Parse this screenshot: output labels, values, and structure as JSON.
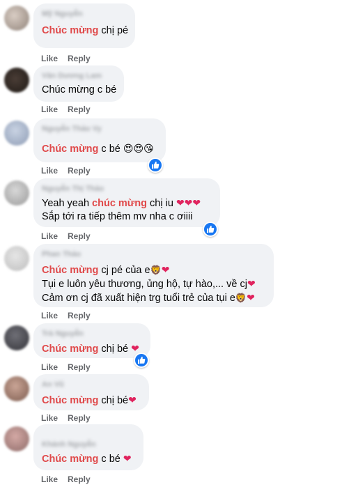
{
  "actions": {
    "like_label": "Like",
    "reply_label": "Reply"
  },
  "comments": [
    {
      "author": "Mỹ Nguyễn",
      "lines": [
        {
          "highlight": "Chúc mừng",
          "text": " chị pé"
        }
      ]
    },
    {
      "author": "Vân Dương Lam",
      "lines": [
        {
          "highlight": "",
          "text": "Chúc mừng c bé"
        }
      ]
    },
    {
      "author": "Nguyễn Thảo Vy",
      "lines": [
        {
          "highlight": "Chúc mừng",
          "text": " c bé",
          "suffix": "😍😍😘"
        }
      ]
    },
    {
      "author": "Nguyễn Thị Thảo",
      "lines": [
        {
          "prefix": "Yeah yeah ",
          "highlight": "chúc mừng",
          "text": " chị iu",
          "hearts": "❤❤❤"
        },
        {
          "text": "Sắp tới ra tiếp thêm mv nha c ơiiii"
        }
      ]
    },
    {
      "author": "Phan Thảo",
      "lines": [
        {
          "highlight": "Chúc mừng",
          "text": " cj pé của e",
          "lion": "🦁",
          "hearts": "❤"
        },
        {
          "text": "Tụi e luôn yêu thương, ủng hộ, tự hào,... về cj",
          "hearts": "❤"
        },
        {
          "text": "Cảm ơn cj đã xuất hiện trg tuổi trẻ của tụi e",
          "lion": "🦁",
          "hearts": "❤"
        }
      ]
    },
    {
      "author": "Trà Nguyễn",
      "lines": [
        {
          "highlight": "Chúc mừng",
          "text": " chị bé ",
          "hearts": "❤"
        }
      ]
    },
    {
      "author": "An Vũ",
      "lines": [
        {
          "highlight": "Chúc mừng",
          "text": " chị bé",
          "hearts": "❤"
        }
      ]
    },
    {
      "author": "Khánh Nguyễn",
      "lines": [
        {
          "highlight": "Chúc mừng",
          "text": " c bé ",
          "hearts": "❤"
        }
      ]
    }
  ],
  "colors": {
    "highlight": "#e0494a",
    "heart": "#e0245e",
    "like_badge": "#1877f2",
    "bubble": "#f0f2f5"
  }
}
